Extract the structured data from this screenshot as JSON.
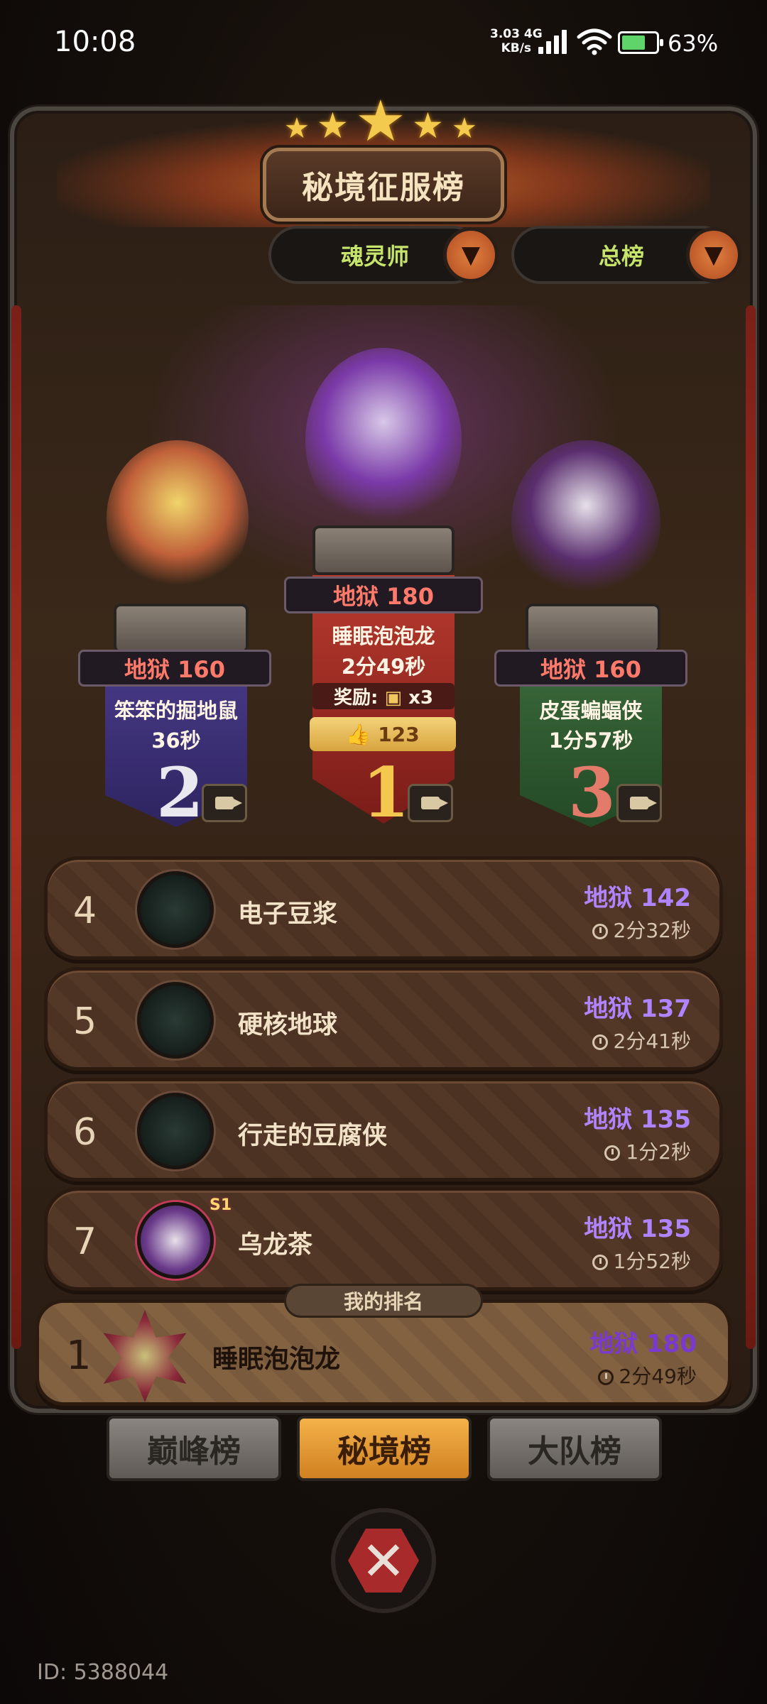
{
  "status_bar": {
    "time": "10:08",
    "speed_value": "3.03",
    "speed_unit": "KB/s",
    "network": "4G",
    "battery": "63%"
  },
  "title": "秘境征服榜",
  "filters": {
    "class": "魂灵师",
    "scope": "总榜"
  },
  "podium": [
    {
      "place": "1",
      "level": "地狱 180",
      "name": "睡眠泡泡龙",
      "time": "2分49秒",
      "reward_label": "奖励:",
      "reward_qty": "x3",
      "likes": "123",
      "color": "#a8302a"
    },
    {
      "place": "2",
      "level": "地狱 160",
      "name": "笨笨的掘地鼠",
      "time": "36秒",
      "color": "#3a2e6e"
    },
    {
      "place": "3",
      "level": "地狱 160",
      "name": "皮蛋蝙蝠侠",
      "time": "1分57秒",
      "color": "#2e5a34"
    }
  ],
  "list": [
    {
      "rank": "4",
      "name": "电子豆浆",
      "level": "地狱 142",
      "time": "2分32秒"
    },
    {
      "rank": "5",
      "name": "硬核地球",
      "level": "地狱 137",
      "time": "2分41秒"
    },
    {
      "rank": "6",
      "name": "行走的豆腐侠",
      "level": "地狱 135",
      "time": "1分2秒"
    },
    {
      "rank": "7",
      "name": "乌龙茶",
      "level": "地狱 135",
      "time": "1分52秒",
      "badge": "S1"
    }
  ],
  "my_rank": {
    "label": "我的排名",
    "rank": "1",
    "name": "睡眠泡泡龙",
    "level": "地狱 180",
    "time": "2分49秒"
  },
  "tabs": [
    "巅峰榜",
    "秘境榜",
    "大队榜"
  ],
  "active_tab": "秘境榜",
  "footer_id": "ID: 5388044"
}
